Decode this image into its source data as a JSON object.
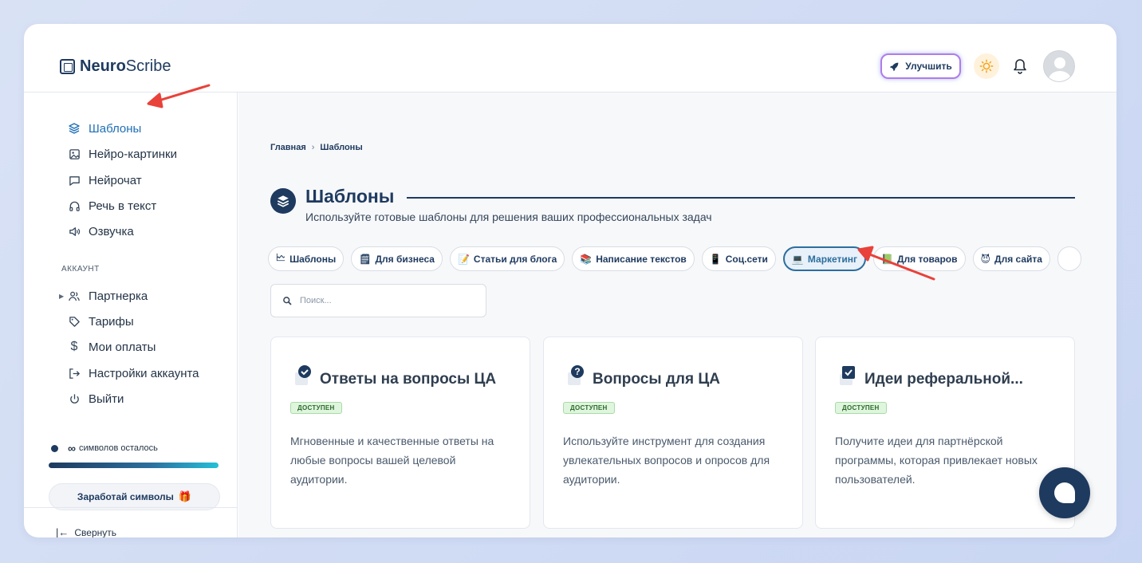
{
  "brand": {
    "bold": "Neuro",
    "light": "Scribe"
  },
  "header": {
    "upgrade_label": "Улучшить"
  },
  "sidebar": {
    "items": [
      {
        "label": "Шаблоны"
      },
      {
        "label": "Нейро-картинки"
      },
      {
        "label": "Нейрочат"
      },
      {
        "label": "Речь в текст"
      },
      {
        "label": "Озвучка"
      }
    ],
    "account_label": "АККАУНТ",
    "account_items": [
      {
        "label": "Партнерка"
      },
      {
        "label": "Тарифы"
      },
      {
        "label": "Мои оплаты"
      },
      {
        "label": "Настройки аккаунта"
      },
      {
        "label": "Выйти"
      }
    ],
    "symbols_value": "∞",
    "symbols_text": "символов осталось",
    "symbols_progress": 1.0,
    "earn_label": "Заработай символы",
    "collapse_label": "Свернуть"
  },
  "breadcrumb": {
    "home": "Главная",
    "sep": "›",
    "current": "Шаблоны"
  },
  "page": {
    "title": "Шаблоны",
    "subtitle": "Используйте готовые шаблоны для решения ваших профессиональных задач"
  },
  "chips": [
    {
      "emoji": "🗠",
      "label": "Шаблоны"
    },
    {
      "emoji": "🗒",
      "label": "Для бизнеса"
    },
    {
      "emoji": "📝",
      "label": "Статьи для блога"
    },
    {
      "emoji": "📚",
      "label": "Написание текстов"
    },
    {
      "emoji": "📱",
      "label": "Соц.сети"
    },
    {
      "emoji": "💻",
      "label": "Маркетинг"
    },
    {
      "emoji": "📗",
      "label": "Для товаров"
    },
    {
      "emoji": "😈",
      "label": "Для сайта"
    }
  ],
  "search": {
    "placeholder": "Поиск..."
  },
  "cards": [
    {
      "title": "Ответы на вопросы ЦА",
      "badge": "ДОСТУПЕН",
      "desc": "Мгновенные и качественные ответы на любые вопросы вашей целевой аудитории."
    },
    {
      "title": "Вопросы для ЦА",
      "badge": "ДОСТУПЕН",
      "desc": "Используйте инструмент для создания увлекательных вопросов и опросов для аудитории."
    },
    {
      "title": "Идеи реферальной...",
      "badge": "ДОСТУПЕН",
      "desc": "Получите идеи для партнёрской программы, которая привлекает новых пользователей."
    }
  ],
  "colors": {
    "accent": "#1e3a5f",
    "active": "#1f6fb5",
    "badge_bg": "#dff5de",
    "annotation": "#e8423a"
  }
}
